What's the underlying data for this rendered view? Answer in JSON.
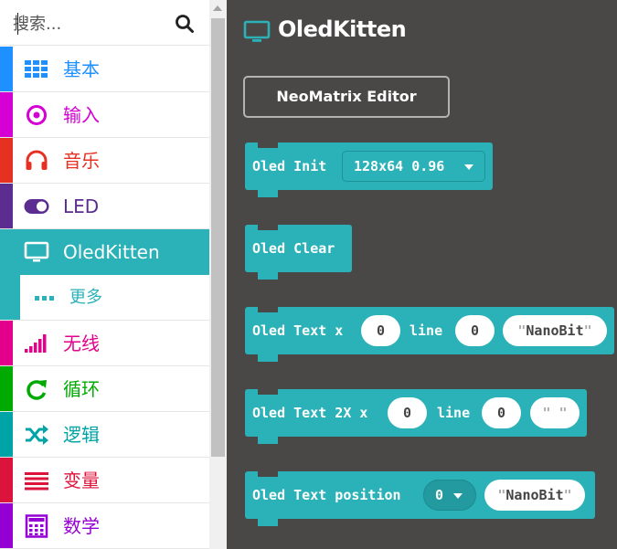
{
  "search": {
    "placeholder": "搜索..."
  },
  "categories": [
    {
      "label": "基本",
      "icon": "grid-icon",
      "color": "#1e90ff"
    },
    {
      "label": "输入",
      "icon": "target-icon",
      "color": "#d400d4"
    },
    {
      "label": "音乐",
      "icon": "headphones-icon",
      "color": "#e63022"
    },
    {
      "label": "LED",
      "icon": "toggle-icon",
      "color": "#5c2d91"
    },
    {
      "label": "OledKitten",
      "icon": "monitor-icon",
      "color": "#2ab2b8"
    },
    {
      "label": "更多",
      "icon": "more-dots-icon",
      "color": "#2ab2b8"
    },
    {
      "label": "无线",
      "icon": "signal-bars-icon",
      "color": "#e3008c"
    },
    {
      "label": "循环",
      "icon": "refresh-icon",
      "color": "#00aa00"
    },
    {
      "label": "逻辑",
      "icon": "shuffle-icon",
      "color": "#00a4a6"
    },
    {
      "label": "变量",
      "icon": "list-lines-icon",
      "color": "#dc143c"
    },
    {
      "label": "数学",
      "icon": "calculator-icon",
      "color": "#9400d3"
    }
  ],
  "workspace": {
    "title": "OledKitten",
    "neomatrix_button": "NeoMatrix Editor",
    "blocks": {
      "init": {
        "text": "Oled Init",
        "dropdown": "128x64 0.96"
      },
      "clear": {
        "text": "Oled Clear"
      },
      "text": {
        "part1": "Oled Text x",
        "x": "0",
        "part2": "line",
        "line": "0",
        "string": "NanoBit"
      },
      "text2x": {
        "part1": "Oled Text 2X x",
        "x": "0",
        "part2": "line",
        "line": "0",
        "string": " "
      },
      "position": {
        "part1": "Oled Text position",
        "dropdown": "0",
        "string": "NanoBit"
      }
    }
  }
}
